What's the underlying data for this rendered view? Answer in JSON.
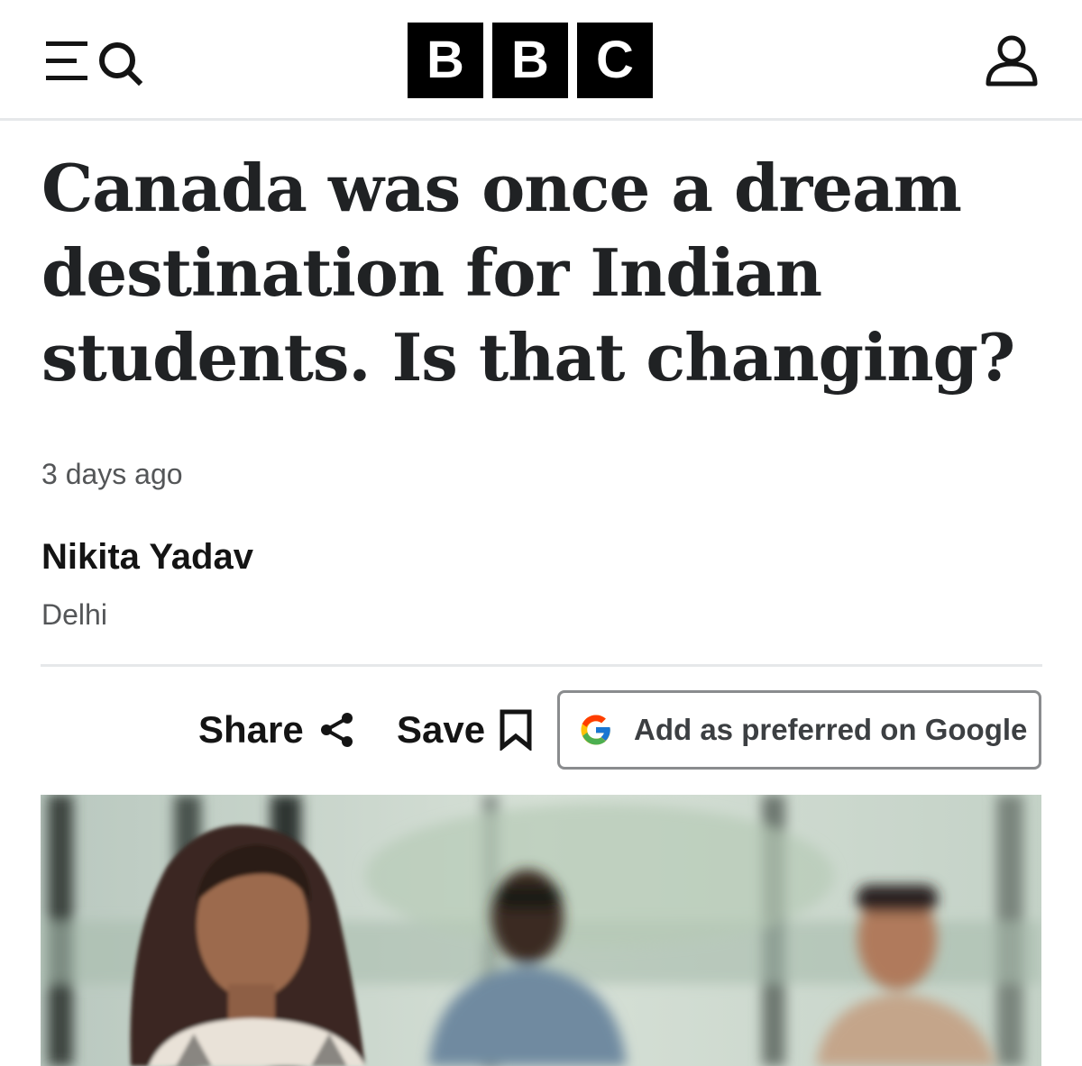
{
  "header": {
    "menu_icon": "menu-icon",
    "search_icon": "search-icon",
    "logo_letters": [
      "B",
      "B",
      "C"
    ],
    "account_icon": "account-icon"
  },
  "article": {
    "headline": "Canada was once a dream destination for Indian students. Is that changing?",
    "timestamp": "3 days ago",
    "author": "Nikita Yadav",
    "location": "Delhi"
  },
  "actions": {
    "share_label": "Share",
    "share_icon": "share-icon",
    "save_label": "Save",
    "save_icon": "bookmark-icon",
    "google_label": "Add as preferred on Google",
    "google_icon": "google-g-icon"
  },
  "hero_image": {
    "description_icon": "photo-students"
  },
  "colors": {
    "text_primary": "#141414",
    "text_secondary": "#545658",
    "divider": "#e6e8ea",
    "logo_bg": "#000000",
    "logo_fg": "#ffffff"
  }
}
